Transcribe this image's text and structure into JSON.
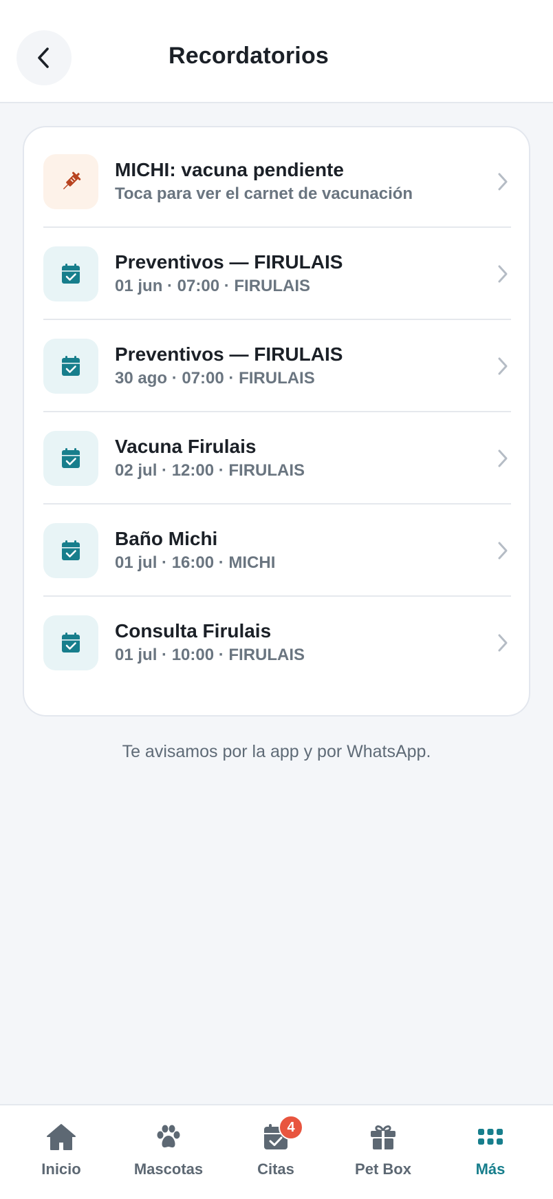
{
  "header": {
    "title": "Recordatorios"
  },
  "reminders": [
    {
      "title": "MICHI: vacuna pendiente",
      "subtitle": "Toca para ver el carnet de vacunación",
      "icon": "syringe-icon"
    },
    {
      "title": "Preventivos — FIRULAIS",
      "subtitle": "01 jun · 07:00 · FIRULAIS",
      "icon": "calendar-check-icon"
    },
    {
      "title": "Preventivos — FIRULAIS",
      "subtitle": "30 ago · 07:00 · FIRULAIS",
      "icon": "calendar-check-icon"
    },
    {
      "title": "Vacuna Firulais",
      "subtitle": "02 jul · 12:00 · FIRULAIS",
      "icon": "calendar-check-icon"
    },
    {
      "title": "Baño Michi",
      "subtitle": "01 jul · 16:00 · MICHI",
      "icon": "calendar-check-icon"
    },
    {
      "title": "Consulta Firulais",
      "subtitle": "01 jul · 10:00 · FIRULAIS",
      "icon": "calendar-check-icon"
    }
  ],
  "note": "Te avisamos por la app y por WhatsApp.",
  "tabbar": {
    "tabs": [
      {
        "label": "Inicio",
        "icon": "home-icon"
      },
      {
        "label": "Mascotas",
        "icon": "paw-icon"
      },
      {
        "label": "Citas",
        "icon": "calendar-check-icon",
        "badge": "4"
      },
      {
        "label": "Pet Box",
        "icon": "gift-icon"
      },
      {
        "label": "Más",
        "icon": "grid-icon"
      }
    ],
    "active": "Más"
  },
  "colors": {
    "accent": "#177e8c",
    "badge": "#e8553f",
    "syringe": "#b8431f",
    "syringe_bg": "#fdf2e9",
    "calendar_bg": "#e8f4f6"
  }
}
